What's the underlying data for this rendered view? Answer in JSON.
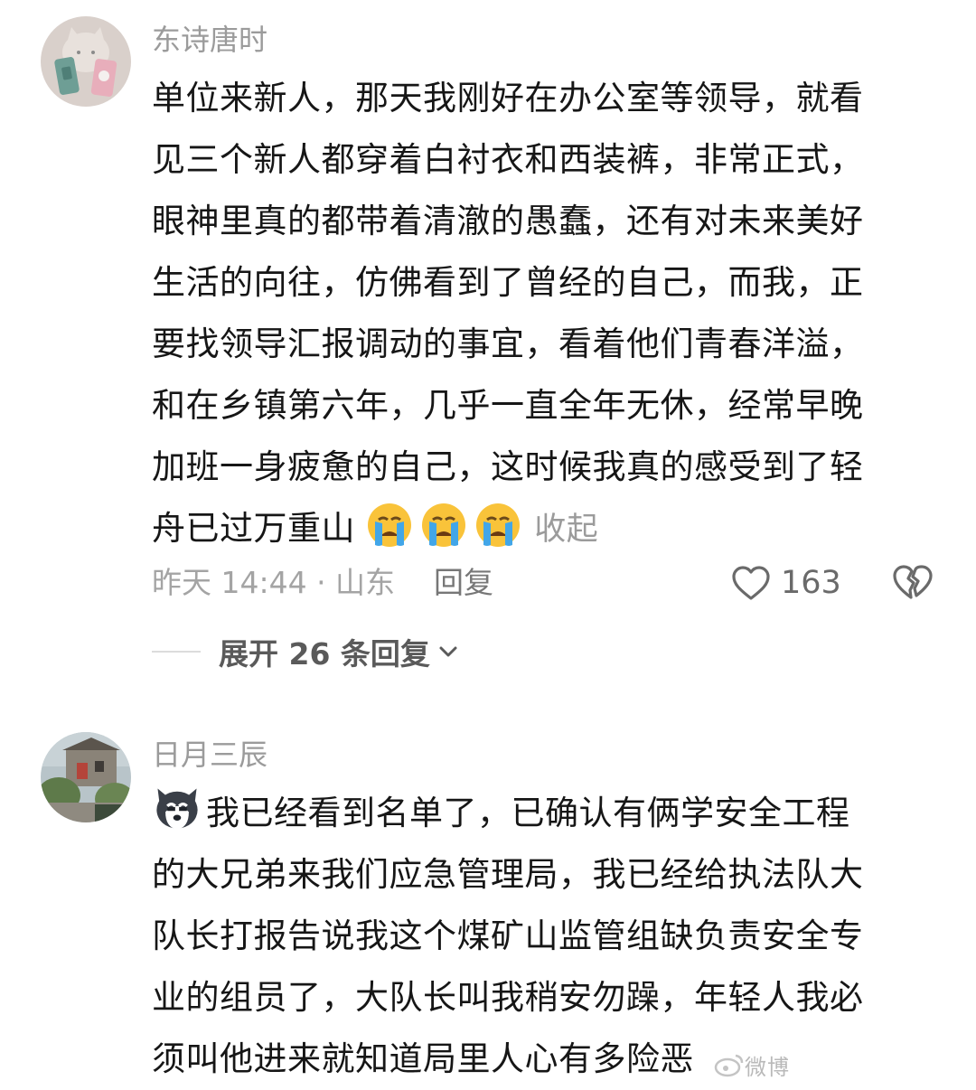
{
  "comments": [
    {
      "username": "东诗唐时",
      "avatar": "cat-phone-case-avatar",
      "lines": [
        "单位来新人，那天我刚好在办公室等领导，就看",
        "见三个新人都穿着白衬衣和西装裤，非常正式，",
        "眼神里真的都带着清澈的愚蠢，还有对未来美好",
        "生活的向往，仿佛看到了曾经的自己，而我，正",
        "要找领导汇报调动的事宜，看着他们青春洋溢，",
        "和在乡镇第六年，几乎一直全年无休，经常早晚",
        "加班一身疲惫的自己，这时候我真的感受到了轻",
        "舟已过万重山"
      ],
      "emojis": [
        "crying-emoji",
        "crying-emoji",
        "crying-emoji"
      ],
      "collapse_label": "收起",
      "meta": "昨天 14:44 · 山东",
      "reply_label": "回复",
      "like_count": "163",
      "expand_label": "展开 26 条回复",
      "colors": {
        "username": "#9b9b9b",
        "text": "#161616",
        "meta": "#a4a4a4"
      }
    },
    {
      "username": "日月三辰",
      "avatar": "village-house-photo-avatar",
      "lead_emoji": "husky-dog-emoji",
      "lines": [
        "我已经看到名单了，已确认有俩学安全工程",
        "的大兄弟来我们应急管理局，我已经给执法队大",
        "队长打报告说我这个煤矿山监管组缺负责安全专",
        "业的组员了，大队长叫我稍安勿躁，年轻人我必",
        "须叫他进来就知道局里人心有多险恶"
      ]
    }
  ],
  "watermark": "微博"
}
